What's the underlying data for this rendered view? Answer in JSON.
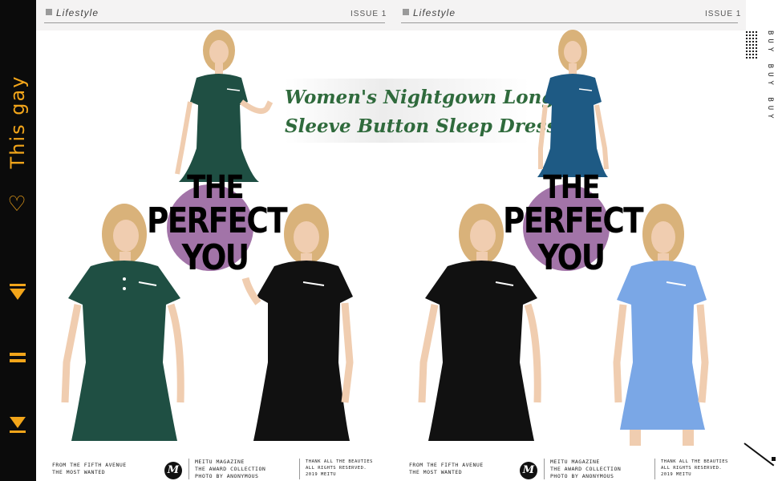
{
  "header": {
    "left": {
      "tag": "Lifestyle",
      "issue": "ISSUE 1"
    },
    "right": {
      "tag": "Lifestyle",
      "issue": "ISSUE 1"
    }
  },
  "rail": {
    "text": "This gay",
    "heart_icon": "heart-outline-icon",
    "icons": [
      "skip-end-icon",
      "pause-icon",
      "skip-start-icon"
    ],
    "accent": "#f2a51a"
  },
  "side": {
    "buy_text": "BUY BUY BUY"
  },
  "banner": {
    "line1": "Women's Nightgown Long",
    "line2": "Sleeve Button Sleep Dress"
  },
  "promo": {
    "line1": "THE",
    "line2": "PERFECT",
    "line3": "YOU"
  },
  "footer": {
    "col1": [
      "FROM THE FIFTH AVENUE",
      "THE MOST WANTED"
    ],
    "logo_letter": "M",
    "col2": [
      "MEITU MAGAZINE",
      "THE AWARD COLLECTION",
      "PHOTO BY ANONYMOUS"
    ],
    "col3": [
      "THANK ALL THE BEAUTIES",
      "ALL RIGHTS RESERVED.",
      "2019 MEITU"
    ]
  },
  "dress_colors": {
    "green": "#1f4f43",
    "teal": "#1e5a84",
    "black": "#111111",
    "light_blue": "#7aa7e6"
  }
}
